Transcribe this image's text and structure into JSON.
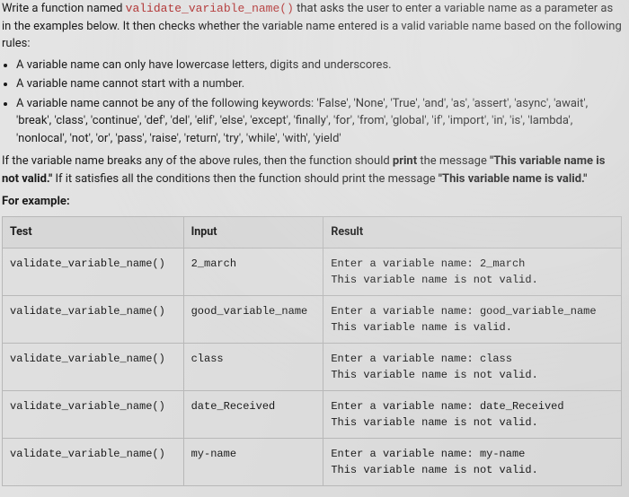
{
  "intro": {
    "line1_prefix": "Write a function named ",
    "fn_name": "validate_variable_name()",
    "line1_suffix": " that asks the user to enter a variable name as a parameter as in the examples below. It then checks whether the variable name entered is a valid variable name based on the following rules:"
  },
  "rules": [
    "A variable name can only have lowercase letters, digits and underscores.",
    "A variable name cannot start with a number.",
    "A variable name cannot be any of the following keywords: 'False', 'None', 'True', 'and', 'as', 'assert', 'async', 'await', 'break', 'class', 'continue', 'def', 'del', 'elif', 'else', 'except', 'finally', 'for', 'from', 'global', 'if', 'import', 'in', 'is', 'lambda', 'nonlocal', 'not', 'or', 'pass', 'raise', 'return', 'try', 'while', 'with', 'yield'"
  ],
  "outcome": {
    "prefix": "If the variable name breaks any of the above rules, then the function should ",
    "print_word1": "print",
    "mid1": " the message ",
    "msg_invalid": "\"This variable name is not valid.\"",
    "mid2": "  If it satisfies all the conditions then the function should print the message ",
    "msg_valid": "\"This variable name is valid.\""
  },
  "example_label": "For example:",
  "table": {
    "headers": {
      "test": "Test",
      "input": "Input",
      "result": "Result"
    },
    "rows": [
      {
        "test": "validate_variable_name()",
        "input": "2_march",
        "result": "Enter a variable name: 2_march\nThis variable name is not valid."
      },
      {
        "test": "validate_variable_name()",
        "input": "good_variable_name",
        "result": "Enter a variable name: good_variable_name\nThis variable name is valid."
      },
      {
        "test": "validate_variable_name()",
        "input": "class",
        "result": "Enter a variable name: class\nThis variable name is not valid."
      },
      {
        "test": "validate_variable_name()",
        "input": "date_Received",
        "result": "Enter a variable name: date_Received\nThis variable name is not valid."
      },
      {
        "test": "validate_variable_name()",
        "input": "my-name",
        "result": "Enter a variable name: my-name\nThis variable name is not valid."
      }
    ]
  }
}
